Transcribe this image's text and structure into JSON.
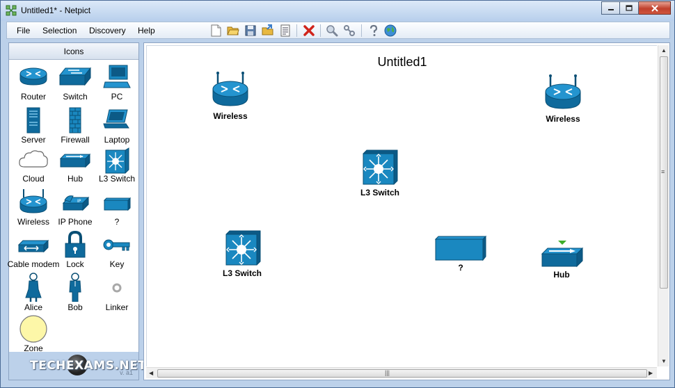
{
  "window": {
    "title": "Untitled1* - Netpict"
  },
  "menu": [
    "File",
    "Selection",
    "Discovery",
    "Help"
  ],
  "toolbar": [
    "new-icon",
    "open-folder-icon",
    "save-icon",
    "export-icon",
    "notes-icon",
    "delete-icon",
    "zoom-icon",
    "link-tool-icon",
    "help-icon",
    "web-icon"
  ],
  "panel": {
    "header": "Icons",
    "items": [
      "Router",
      "Switch",
      "PC",
      "Server",
      "Firewall",
      "Laptop",
      "Cloud",
      "Hub",
      "L3 Switch",
      "Wireless",
      "IP Phone",
      "?",
      "Cable modem",
      "Lock",
      "Key",
      "Alice",
      "Bob",
      "Linker",
      "Zone"
    ],
    "brand": "TECHEXAMS.NET",
    "version": "v. a1"
  },
  "canvas": {
    "title": "Untitled1",
    "nodes": [
      {
        "type": "wireless",
        "label": "Wireless"
      },
      {
        "type": "wireless",
        "label": "Wireless"
      },
      {
        "type": "l3switch",
        "label": "L3 Switch"
      },
      {
        "type": "l3switch",
        "label": "L3 Switch"
      },
      {
        "type": "unknown",
        "label": "?"
      },
      {
        "type": "hub",
        "label": "Hub"
      }
    ]
  },
  "colors": {
    "device": "#1a88c0",
    "device_dark": "#0d5f8f",
    "accent_green": "#3fae2a",
    "window_frame": "#bcd1ea"
  }
}
